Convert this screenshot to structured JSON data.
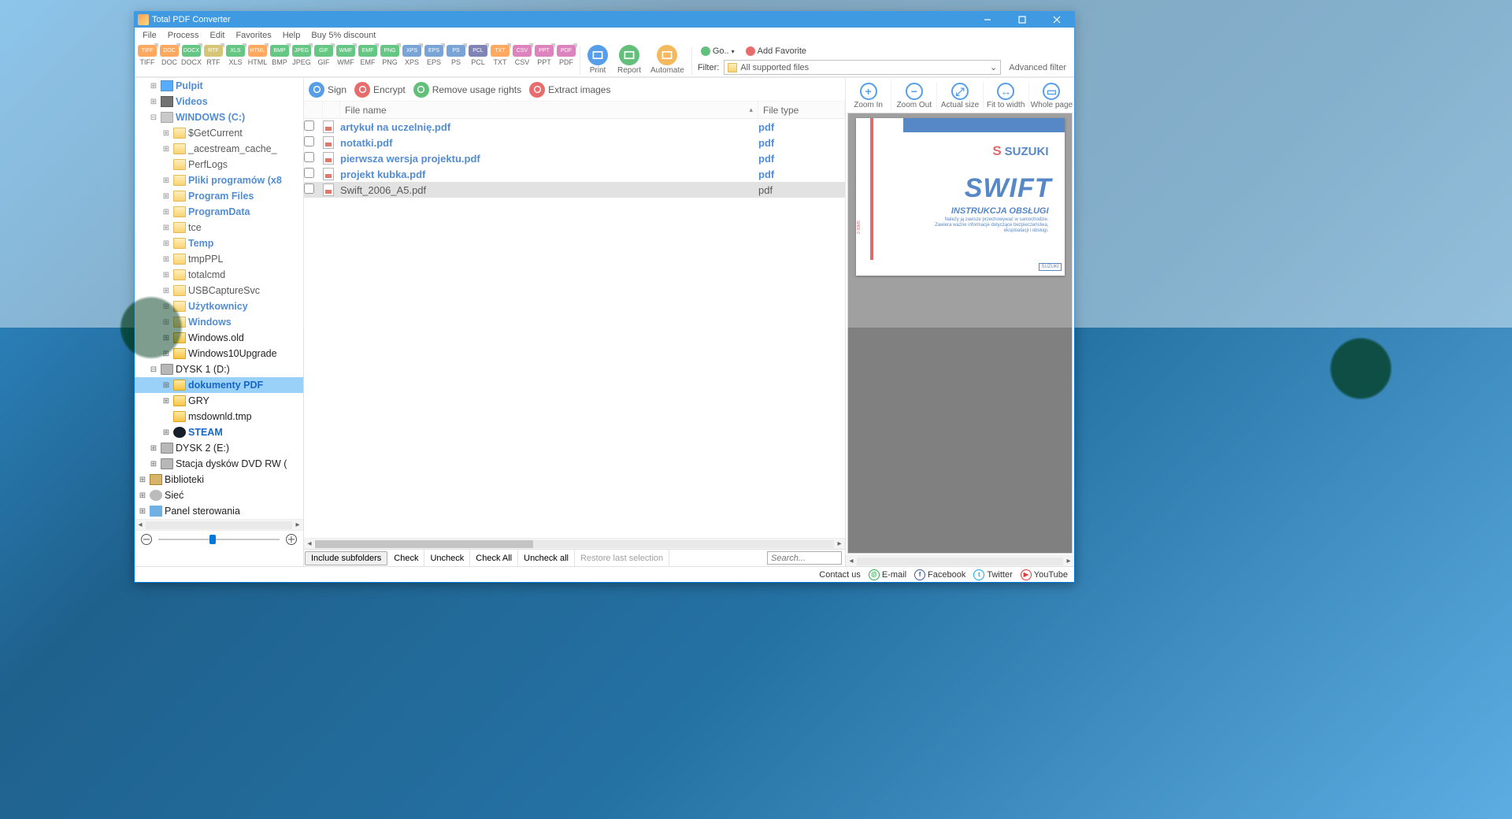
{
  "window": {
    "title": "Total PDF Converter",
    "buttons": {
      "min": "minimize",
      "max": "maximize",
      "close": "close"
    }
  },
  "menu": [
    "File",
    "Process",
    "Edit",
    "Favorites",
    "Help",
    "Buy 5% discount"
  ],
  "formats": [
    {
      "label": "TIFF",
      "chip": "TIFF",
      "color": "#ff8c2b"
    },
    {
      "label": "DOC",
      "chip": "DOC",
      "color": "#ff8c2b"
    },
    {
      "label": "DOCX",
      "chip": "DOCX",
      "color": "#33b35a"
    },
    {
      "label": "RTF",
      "chip": "RTF",
      "color": "#c7b24a"
    },
    {
      "label": "XLS",
      "chip": "XLS",
      "color": "#33b35a"
    },
    {
      "label": "HTML",
      "chip": "HTML",
      "color": "#ff8c2b"
    },
    {
      "label": "BMP",
      "chip": "BMP",
      "color": "#33b35a"
    },
    {
      "label": "JPEG",
      "chip": "JPEG",
      "color": "#33b35a"
    },
    {
      "label": "GIF",
      "chip": "GIF",
      "color": "#33b35a"
    },
    {
      "label": "WMF",
      "chip": "WMF",
      "color": "#33b35a"
    },
    {
      "label": "EMF",
      "chip": "EMF",
      "color": "#33b35a"
    },
    {
      "label": "PNG",
      "chip": "PNG",
      "color": "#33b35a"
    },
    {
      "label": "XPS",
      "chip": "XPS",
      "color": "#4d86c7"
    },
    {
      "label": "EPS",
      "chip": "EPS",
      "color": "#4d86c7"
    },
    {
      "label": "PS",
      "chip": "PS",
      "color": "#4d86c7"
    },
    {
      "label": "PCL",
      "chip": "PCL",
      "color": "#555b9c"
    },
    {
      "label": "TXT",
      "chip": "TXT",
      "color": "#ff8c2b"
    },
    {
      "label": "CSV",
      "chip": "CSV",
      "color": "#d25aa7"
    },
    {
      "label": "PPT",
      "chip": "PPT",
      "color": "#d25aa7"
    },
    {
      "label": "PDF",
      "chip": "PDF",
      "color": "#d25aa7"
    }
  ],
  "big_buttons": [
    {
      "label": "Print",
      "color": "#1e7fe0",
      "icon": "printer-icon"
    },
    {
      "label": "Report",
      "color": "#2eab4d",
      "icon": "report-icon"
    },
    {
      "label": "Automate",
      "color": "#f0a02a",
      "icon": "automate-icon"
    }
  ],
  "top_right": {
    "go": "Go..",
    "add_favorite": "Add Favorite",
    "filter_label": "Filter:",
    "filter_value": "All supported files",
    "advanced": "Advanced filter"
  },
  "actions": [
    {
      "label": "Sign",
      "color": "#1e7fe0",
      "icon": "pen-icon"
    },
    {
      "label": "Encrypt",
      "color": "#e23b3b",
      "icon": "lock-icon"
    },
    {
      "label": "Remove usage rights",
      "color": "#2eab4d",
      "icon": "unlock-icon"
    },
    {
      "label": "Extract images",
      "color": "#e23b3b",
      "icon": "image-icon"
    }
  ],
  "tree": [
    {
      "depth": 0,
      "exp": "⊞",
      "icon": "desk",
      "label": "Pulpit",
      "bold": true
    },
    {
      "depth": 0,
      "exp": "⊞",
      "icon": "vid",
      "label": "Videos",
      "bold": true
    },
    {
      "depth": 0,
      "exp": "⊟",
      "icon": "drive",
      "label": "WINDOWS (C:)",
      "bold": true
    },
    {
      "depth": 1,
      "exp": "⊞",
      "icon": "folder",
      "label": "$GetCurrent"
    },
    {
      "depth": 1,
      "exp": "⊞",
      "icon": "folder",
      "label": "_acestream_cache_"
    },
    {
      "depth": 1,
      "exp": "",
      "icon": "folder",
      "label": "PerfLogs"
    },
    {
      "depth": 1,
      "exp": "⊞",
      "icon": "folder",
      "label": "Pliki programów (x8",
      "bold": true
    },
    {
      "depth": 1,
      "exp": "⊞",
      "icon": "folder",
      "label": "Program Files",
      "bold": true
    },
    {
      "depth": 1,
      "exp": "⊞",
      "icon": "folder",
      "label": "ProgramData",
      "bold": true
    },
    {
      "depth": 1,
      "exp": "⊞",
      "icon": "folder",
      "label": "tce"
    },
    {
      "depth": 1,
      "exp": "⊞",
      "icon": "folder",
      "label": "Temp",
      "bold": true
    },
    {
      "depth": 1,
      "exp": "⊞",
      "icon": "folder",
      "label": "tmpPPL"
    },
    {
      "depth": 1,
      "exp": "⊞",
      "icon": "folder",
      "label": "totalcmd"
    },
    {
      "depth": 1,
      "exp": "⊞",
      "icon": "folder",
      "label": "USBCaptureSvc"
    },
    {
      "depth": 1,
      "exp": "⊞",
      "icon": "folder",
      "label": "Użytkownicy",
      "bold": true
    },
    {
      "depth": 1,
      "exp": "⊞",
      "icon": "folder",
      "label": "Windows",
      "bold": true
    },
    {
      "depth": 1,
      "exp": "⊞",
      "icon": "folder",
      "label": "Windows.old"
    },
    {
      "depth": 1,
      "exp": "⊞",
      "icon": "folder",
      "label": "Windows10Upgrade"
    },
    {
      "depth": 0,
      "exp": "⊟",
      "icon": "drive",
      "label": "DYSK 1 (D:)"
    },
    {
      "depth": 1,
      "exp": "⊞",
      "icon": "folder",
      "label": "dokumenty PDF",
      "selected": true,
      "bold": true
    },
    {
      "depth": 1,
      "exp": "⊞",
      "icon": "folder",
      "label": "GRY"
    },
    {
      "depth": 1,
      "exp": "",
      "icon": "folder",
      "label": "msdownld.tmp"
    },
    {
      "depth": 1,
      "exp": "⊞",
      "icon": "steam",
      "label": "STEAM",
      "bold": true
    },
    {
      "depth": 0,
      "exp": "⊞",
      "icon": "drive",
      "label": "DYSK 2 (E:)"
    },
    {
      "depth": 0,
      "exp": "⊞",
      "icon": "drive",
      "label": "Stacja dysków DVD RW ("
    },
    {
      "depth": -1,
      "exp": "⊞",
      "icon": "lib",
      "label": "Biblioteki"
    },
    {
      "depth": -1,
      "exp": "⊞",
      "icon": "net",
      "label": "Sieć"
    },
    {
      "depth": -1,
      "exp": "⊞",
      "icon": "panel",
      "label": "Panel sterowania"
    }
  ],
  "columns": {
    "name": "File name",
    "type": "File type"
  },
  "files": [
    {
      "name": "artykuł na uczelnię.pdf",
      "type": "pdf",
      "bold": true
    },
    {
      "name": "notatki.pdf",
      "type": "pdf",
      "bold": true
    },
    {
      "name": "pierwsza wersja projektu.pdf",
      "type": "pdf",
      "bold": true
    },
    {
      "name": "projekt kubka.pdf",
      "type": "pdf",
      "bold": true
    },
    {
      "name": "Swift_2006_A5.pdf",
      "type": "pdf",
      "selected": true
    }
  ],
  "bottom": {
    "include": "Include subfolders",
    "check": "Check",
    "uncheck": "Uncheck",
    "check_all": "Check All",
    "uncheck_all": "Uncheck all",
    "restore": "Restore last selection",
    "search_placeholder": "Search..."
  },
  "zoom": [
    "Zoom In",
    "Zoom Out",
    "Actual size",
    "Fit to width",
    "Whole page"
  ],
  "preview": {
    "brand_symbol": "S",
    "brand": "SUZUKI",
    "model": "SWIFT",
    "subtitle": "INSTRUKCJA OBSŁUGI",
    "small": "Należy ją zawsze przechowywać w samochodzie. Zawiera ważne informacje dotyczące bezpieczeństwa, eksploatacji i obsługi.",
    "stamp": "SUZUKI",
    "side": "2-99M5"
  },
  "status": {
    "contact": "Contact us",
    "links": [
      {
        "label": "E-mail",
        "color": "#2eab4d",
        "glyph": "@"
      },
      {
        "label": "Facebook",
        "color": "#3b5998",
        "glyph": "f"
      },
      {
        "label": "Twitter",
        "color": "#1da1f2",
        "glyph": "t"
      },
      {
        "label": "YouTube",
        "color": "#e23b3b",
        "glyph": "▶"
      }
    ]
  }
}
